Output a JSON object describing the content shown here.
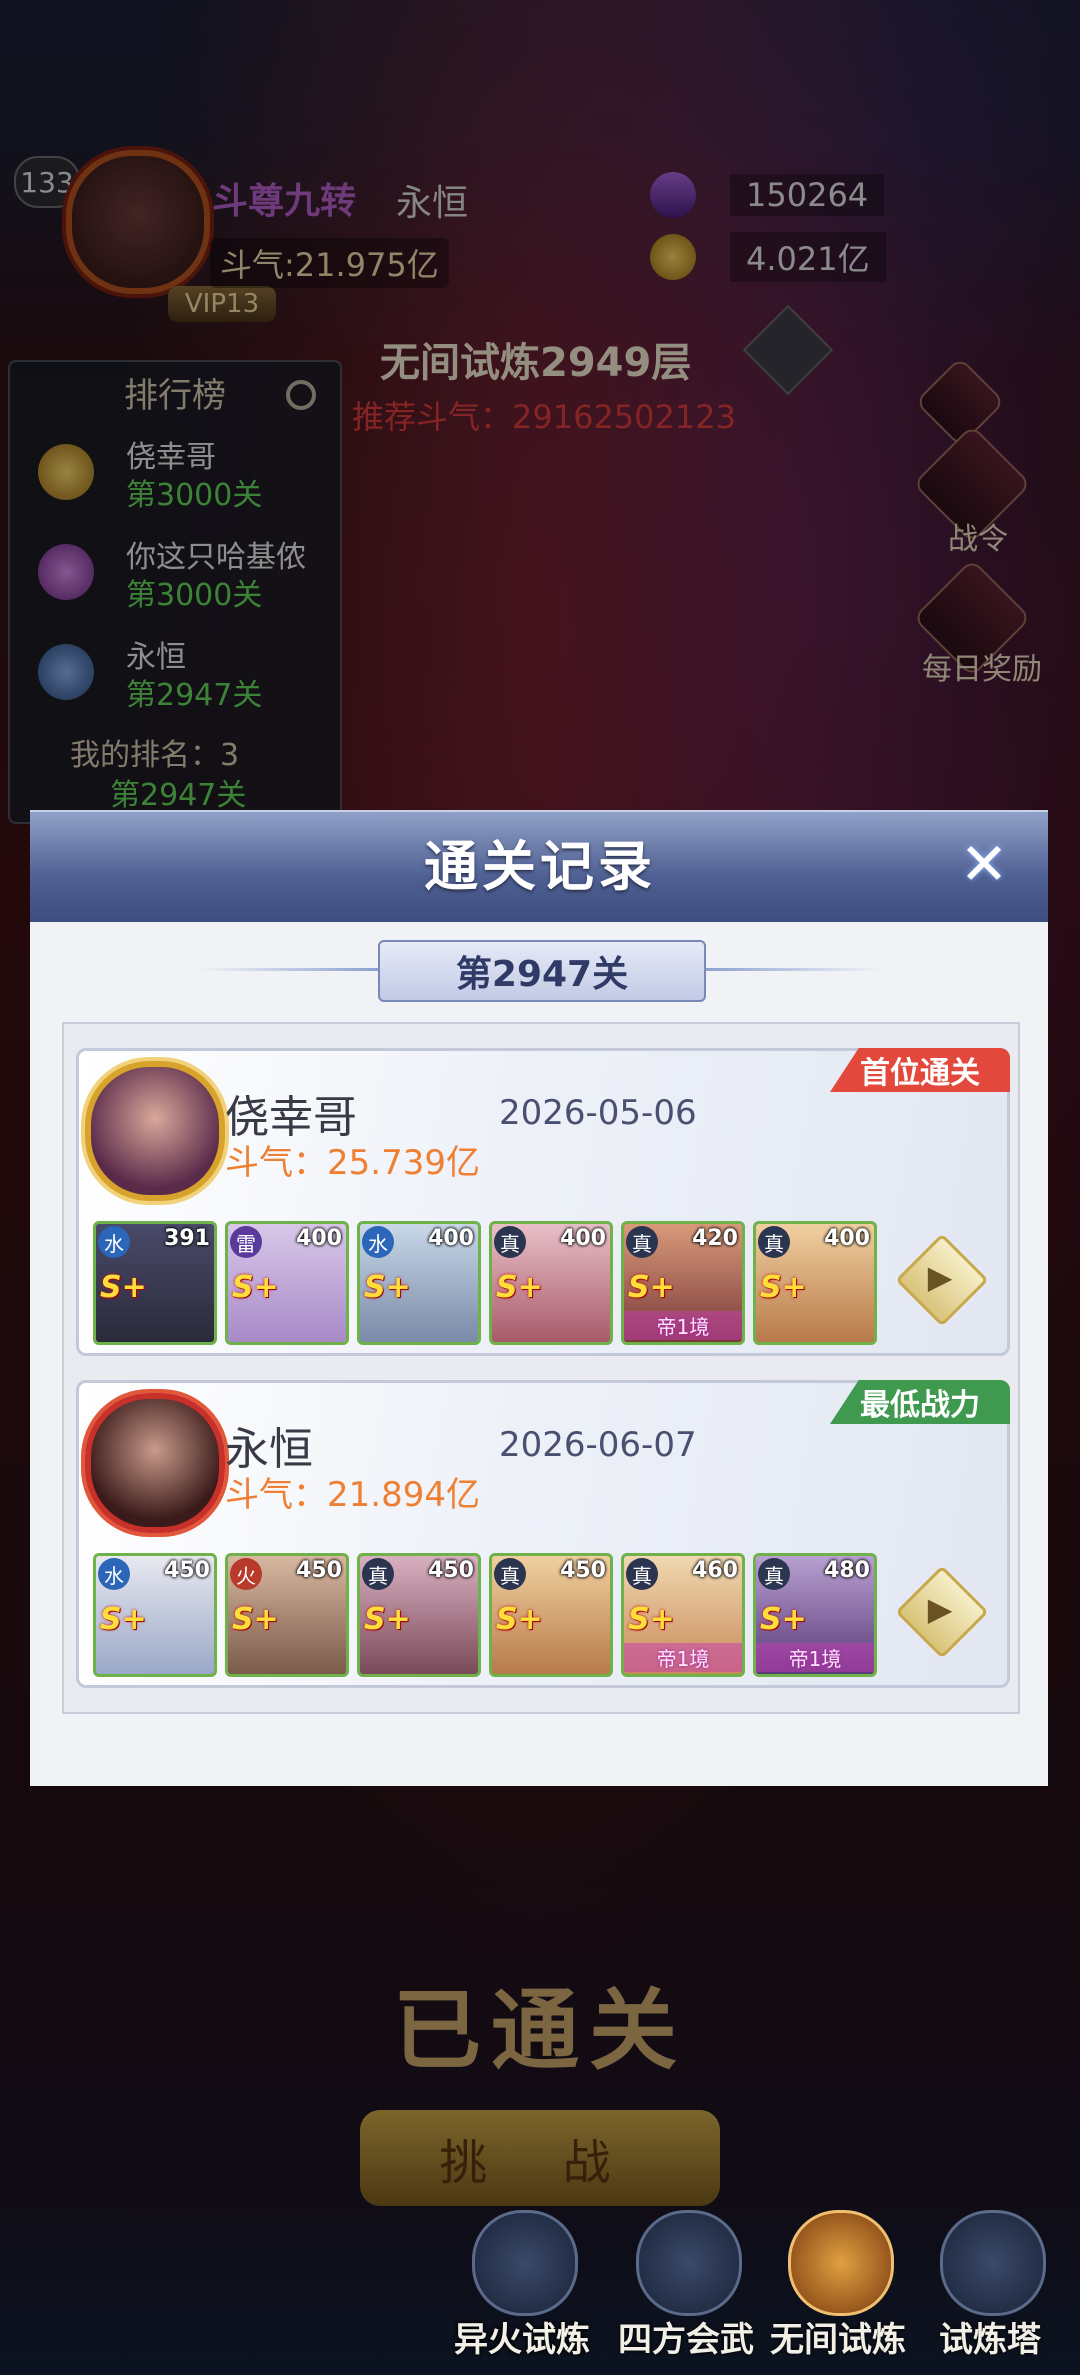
{
  "player": {
    "level": "133",
    "title": "斗尊九转",
    "name": "永恒",
    "power": "斗气:21.975亿",
    "vip": "VIP13",
    "currency_1": "150264",
    "currency_2": "4.021亿"
  },
  "ranking": {
    "title": "排行榜",
    "rows": [
      {
        "rank": "1",
        "name": "侥幸哥",
        "stage": "第3000关"
      },
      {
        "rank": "2",
        "name": "你这只哈基侬",
        "stage": "第3000关"
      },
      {
        "rank": "3",
        "name": "永恒",
        "stage": "第2947关"
      }
    ],
    "my_rank": "我的排名：3",
    "my_stage": "第2947关"
  },
  "trial": {
    "title": "无间试炼2949层",
    "recommended": "推荐斗气：29162502123"
  },
  "side_buttons": [
    "战令",
    "每日奖励"
  ],
  "bottom": {
    "cleared": "已通关",
    "challenge": "挑 战",
    "nav": [
      "异火试炼",
      "四方会武",
      "无间试炼",
      "试炼塔"
    ]
  },
  "modal": {
    "title": "通关记录",
    "close": "✕",
    "stage": "第2947关",
    "records": [
      {
        "name": "侥幸哥",
        "power": "斗气：25.739亿",
        "date": "2026-05-06",
        "tag": "首位通关",
        "tag_color": "#e2483c",
        "heroes": [
          {
            "element": "水",
            "level": "391",
            "grade": "S+",
            "note": ""
          },
          {
            "element": "雷",
            "level": "400",
            "grade": "S+",
            "note": ""
          },
          {
            "element": "水",
            "level": "400",
            "grade": "S+",
            "note": ""
          },
          {
            "element": "真",
            "level": "400",
            "grade": "S+",
            "note": ""
          },
          {
            "element": "真",
            "level": "420",
            "grade": "S+",
            "note": "帝1境"
          },
          {
            "element": "真",
            "level": "400",
            "grade": "S+",
            "note": ""
          }
        ]
      },
      {
        "name": "永恒",
        "power": "斗气：21.894亿",
        "date": "2026-06-07",
        "tag": "最低战力",
        "tag_color": "#3f9a4f",
        "heroes": [
          {
            "element": "水",
            "level": "450",
            "grade": "S+",
            "note": ""
          },
          {
            "element": "火",
            "level": "450",
            "grade": "S+",
            "note": ""
          },
          {
            "element": "真",
            "level": "450",
            "grade": "S+",
            "note": ""
          },
          {
            "element": "真",
            "level": "450",
            "grade": "S+",
            "note": ""
          },
          {
            "element": "真",
            "level": "460",
            "grade": "S+",
            "note": "帝1境"
          },
          {
            "element": "真",
            "level": "480",
            "grade": "S+",
            "note": "帝1境"
          }
        ]
      }
    ]
  }
}
